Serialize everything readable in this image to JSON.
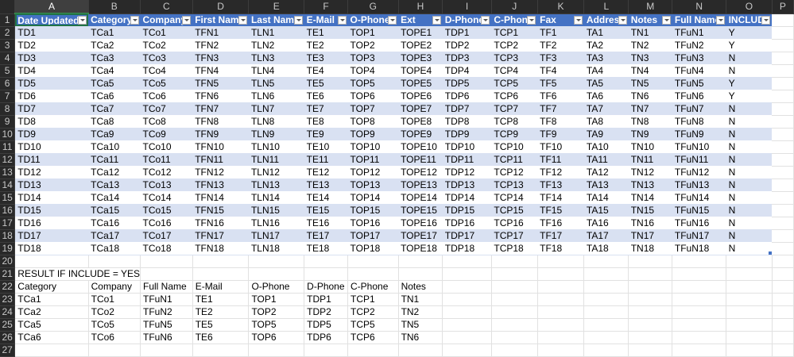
{
  "columns": [
    "A",
    "B",
    "C",
    "D",
    "E",
    "F",
    "G",
    "H",
    "I",
    "J",
    "K",
    "L",
    "M",
    "N",
    "O",
    "P"
  ],
  "selected_cell": "A1",
  "table": {
    "headers": [
      "Date Updated",
      "Category",
      "Company",
      "First Name",
      "Last Name",
      "E-Mail",
      "O-Phone",
      "Ext",
      "D-Phone",
      "C-Phone",
      "Fax",
      "Address",
      "Notes",
      "Full Name",
      "INCLUD"
    ],
    "rows": [
      [
        "TD1",
        "TCa1",
        "TCo1",
        "TFN1",
        "TLN1",
        "TE1",
        "TOP1",
        "TOPE1",
        "TDP1",
        "TCP1",
        "TF1",
        "TA1",
        "TN1",
        "TFuN1",
        "Y"
      ],
      [
        "TD2",
        "TCa2",
        "TCo2",
        "TFN2",
        "TLN2",
        "TE2",
        "TOP2",
        "TOPE2",
        "TDP2",
        "TCP2",
        "TF2",
        "TA2",
        "TN2",
        "TFuN2",
        "Y"
      ],
      [
        "TD3",
        "TCa3",
        "TCo3",
        "TFN3",
        "TLN3",
        "TE3",
        "TOP3",
        "TOPE3",
        "TDP3",
        "TCP3",
        "TF3",
        "TA3",
        "TN3",
        "TFuN3",
        "N"
      ],
      [
        "TD4",
        "TCa4",
        "TCo4",
        "TFN4",
        "TLN4",
        "TE4",
        "TOP4",
        "TOPE4",
        "TDP4",
        "TCP4",
        "TF4",
        "TA4",
        "TN4",
        "TFuN4",
        "N"
      ],
      [
        "TD5",
        "TCa5",
        "TCo5",
        "TFN5",
        "TLN5",
        "TE5",
        "TOP5",
        "TOPE5",
        "TDP5",
        "TCP5",
        "TF5",
        "TA5",
        "TN5",
        "TFuN5",
        "Y"
      ],
      [
        "TD6",
        "TCa6",
        "TCo6",
        "TFN6",
        "TLN6",
        "TE6",
        "TOP6",
        "TOPE6",
        "TDP6",
        "TCP6",
        "TF6",
        "TA6",
        "TN6",
        "TFuN6",
        "Y"
      ],
      [
        "TD7",
        "TCa7",
        "TCo7",
        "TFN7",
        "TLN7",
        "TE7",
        "TOP7",
        "TOPE7",
        "TDP7",
        "TCP7",
        "TF7",
        "TA7",
        "TN7",
        "TFuN7",
        "N"
      ],
      [
        "TD8",
        "TCa8",
        "TCo8",
        "TFN8",
        "TLN8",
        "TE8",
        "TOP8",
        "TOPE8",
        "TDP8",
        "TCP8",
        "TF8",
        "TA8",
        "TN8",
        "TFuN8",
        "N"
      ],
      [
        "TD9",
        "TCa9",
        "TCo9",
        "TFN9",
        "TLN9",
        "TE9",
        "TOP9",
        "TOPE9",
        "TDP9",
        "TCP9",
        "TF9",
        "TA9",
        "TN9",
        "TFuN9",
        "N"
      ],
      [
        "TD10",
        "TCa10",
        "TCo10",
        "TFN10",
        "TLN10",
        "TE10",
        "TOP10",
        "TOPE10",
        "TDP10",
        "TCP10",
        "TF10",
        "TA10",
        "TN10",
        "TFuN10",
        "N"
      ],
      [
        "TD11",
        "TCa11",
        "TCo11",
        "TFN11",
        "TLN11",
        "TE11",
        "TOP11",
        "TOPE11",
        "TDP11",
        "TCP11",
        "TF11",
        "TA11",
        "TN11",
        "TFuN11",
        "N"
      ],
      [
        "TD12",
        "TCa12",
        "TCo12",
        "TFN12",
        "TLN12",
        "TE12",
        "TOP12",
        "TOPE12",
        "TDP12",
        "TCP12",
        "TF12",
        "TA12",
        "TN12",
        "TFuN12",
        "N"
      ],
      [
        "TD13",
        "TCa13",
        "TCo13",
        "TFN13",
        "TLN13",
        "TE13",
        "TOP13",
        "TOPE13",
        "TDP13",
        "TCP13",
        "TF13",
        "TA13",
        "TN13",
        "TFuN13",
        "N"
      ],
      [
        "TD14",
        "TCa14",
        "TCo14",
        "TFN14",
        "TLN14",
        "TE14",
        "TOP14",
        "TOPE14",
        "TDP14",
        "TCP14",
        "TF14",
        "TA14",
        "TN14",
        "TFuN14",
        "N"
      ],
      [
        "TD15",
        "TCa15",
        "TCo15",
        "TFN15",
        "TLN15",
        "TE15",
        "TOP15",
        "TOPE15",
        "TDP15",
        "TCP15",
        "TF15",
        "TA15",
        "TN15",
        "TFuN15",
        "N"
      ],
      [
        "TD16",
        "TCa16",
        "TCo16",
        "TFN16",
        "TLN16",
        "TE16",
        "TOP16",
        "TOPE16",
        "TDP16",
        "TCP16",
        "TF16",
        "TA16",
        "TN16",
        "TFuN16",
        "N"
      ],
      [
        "TD17",
        "TCa17",
        "TCo17",
        "TFN17",
        "TLN17",
        "TE17",
        "TOP17",
        "TOPE17",
        "TDP17",
        "TCP17",
        "TF17",
        "TA17",
        "TN17",
        "TFuN17",
        "N"
      ],
      [
        "TD18",
        "TCa18",
        "TCo18",
        "TFN18",
        "TLN18",
        "TE18",
        "TOP18",
        "TOPE18",
        "TDP18",
        "TCP18",
        "TF18",
        "TA18",
        "TN18",
        "TFuN18",
        "N"
      ]
    ]
  },
  "result": {
    "title": "RESULT IF INCLUDE = YES",
    "headers": [
      "Category",
      "Company",
      "Full Name",
      "E-Mail",
      "O-Phone",
      "D-Phone",
      "C-Phone",
      "Notes"
    ],
    "rows": [
      [
        "TCa1",
        "TCo1",
        "TFuN1",
        "TE1",
        "TOP1",
        "TDP1",
        "TCP1",
        "TN1"
      ],
      [
        "TCa2",
        "TCo2",
        "TFuN2",
        "TE2",
        "TOP2",
        "TDP2",
        "TCP2",
        "TN2"
      ],
      [
        "TCa5",
        "TCo5",
        "TFuN5",
        "TE5",
        "TOP5",
        "TDP5",
        "TCP5",
        "TN5"
      ],
      [
        "TCa6",
        "TCo6",
        "TFuN6",
        "TE6",
        "TOP6",
        "TDP6",
        "TCP6",
        "TN6"
      ]
    ]
  },
  "colors": {
    "table_header": "#4472c4",
    "band": "#d9e1f2",
    "chrome": "#292929"
  }
}
